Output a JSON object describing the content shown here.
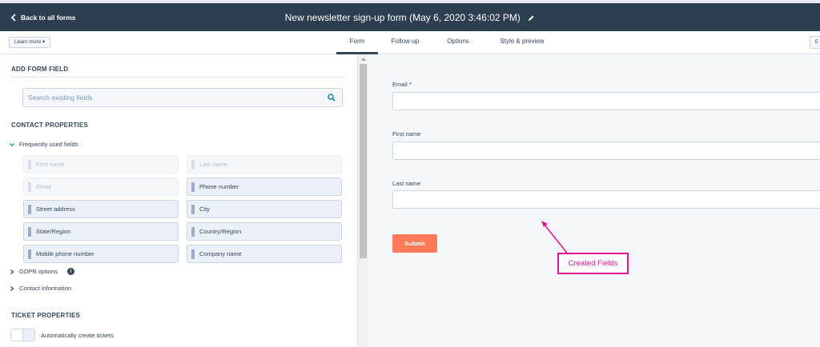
{
  "header": {
    "back_label": "Back to all forms",
    "title": "New newsletter sign-up form (May 6, 2020 3:46:02 PM)"
  },
  "subbar": {
    "learn_more": "Learn more ▾",
    "tabs": [
      {
        "label": "Form",
        "active": true
      },
      {
        "label": "Follow-up",
        "active": false
      },
      {
        "label": "Options",
        "active": false
      },
      {
        "label": "Style & preview",
        "active": false
      }
    ],
    "edge_button": "E"
  },
  "sidebar": {
    "add_field_heading": "ADD FORM FIELD",
    "search_placeholder": "Search existing fields",
    "contact_heading": "CONTACT PROPERTIES",
    "frequent_group": "Frequently used fields",
    "fields": [
      {
        "label": "First name",
        "used": true
      },
      {
        "label": "Last name",
        "used": true
      },
      {
        "label": "Email",
        "used": true
      },
      {
        "label": "Phone number",
        "used": false
      },
      {
        "label": "Street address",
        "used": false
      },
      {
        "label": "City",
        "used": false
      },
      {
        "label": "State/Region",
        "used": false
      },
      {
        "label": "Country/Region",
        "used": false
      },
      {
        "label": "Mobile phone number",
        "used": false
      },
      {
        "label": "Company name",
        "used": false
      }
    ],
    "gdpr_group": "GDPR options",
    "contact_info_group": "Contact information",
    "ticket_heading": "TICKET PROPERTIES",
    "auto_ticket_label": "Automatically create tickets"
  },
  "preview": {
    "fields": [
      {
        "label": "Email *"
      },
      {
        "label": "First name"
      },
      {
        "label": "Last name"
      }
    ],
    "submit_label": "Submit",
    "annotation": "Created Fields"
  },
  "colors": {
    "header_bg": "#2d3e50",
    "submit": "#ff7a59",
    "annotation": "#e5138e"
  }
}
